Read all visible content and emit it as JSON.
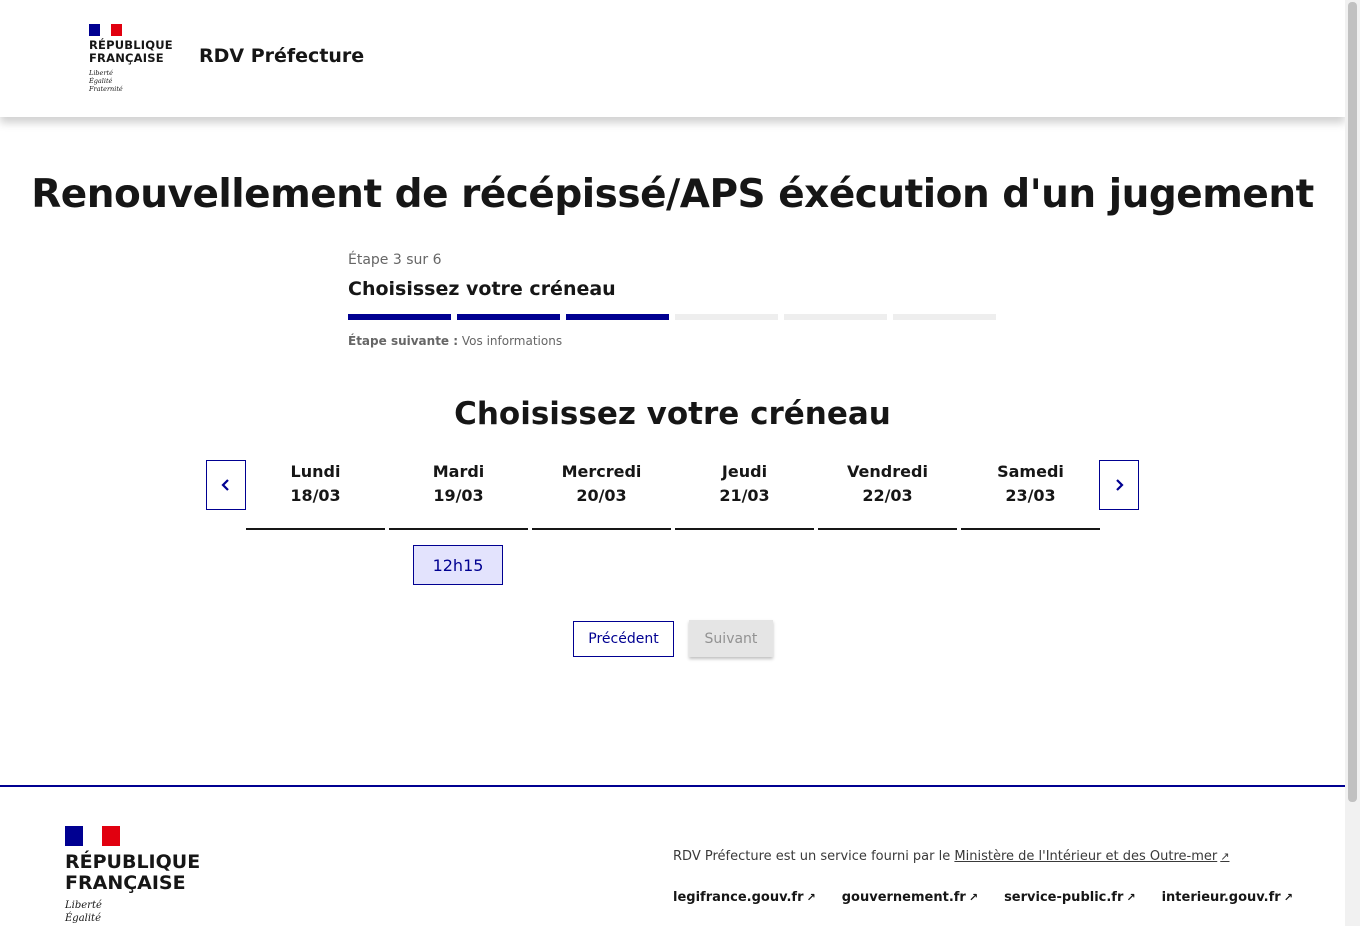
{
  "header": {
    "republic_lines": [
      "RÉPUBLIQUE",
      "FRANÇAISE"
    ],
    "motto_lines": [
      "Liberté",
      "Égalité",
      "Fraternité"
    ],
    "service_title": "RDV Préfecture"
  },
  "page_title": "Renouvellement de récépissé/APS éxécution d'un jugement",
  "stepper": {
    "state": "Étape 3 sur 6",
    "title": "Choisissez votre créneau",
    "total_steps": 6,
    "current_step": 3,
    "next_label": "Étape suivante :",
    "next_value": "Vos informations"
  },
  "slots": {
    "title": "Choisissez votre créneau",
    "days": [
      {
        "name": "Lundi",
        "date": "18/03"
      },
      {
        "name": "Mardi",
        "date": "19/03"
      },
      {
        "name": "Mercredi",
        "date": "20/03"
      },
      {
        "name": "Jeudi",
        "date": "21/03"
      },
      {
        "name": "Vendredi",
        "date": "22/03"
      },
      {
        "name": "Samedi",
        "date": "23/03"
      }
    ],
    "available_slot": "12h15"
  },
  "buttons": {
    "previous": "Précédent",
    "next": "Suivant"
  },
  "footer": {
    "republic_lines": [
      "RÉPUBLIQUE",
      "FRANÇAISE"
    ],
    "motto_lines": [
      "Liberté",
      "Égalité"
    ],
    "description_prefix": "RDV Préfecture est un service fourni par le",
    "description_link": "Ministère de l'Intérieur et des Outre-mer",
    "links": [
      "legifrance.gouv.fr",
      "gouvernement.fr",
      "service-public.fr",
      "interieur.gouv.fr"
    ]
  },
  "colors": {
    "primary": "#000091",
    "flag_red": "#e1000f",
    "slot_bg": "#e3e3fd",
    "disabled_bg": "#e5e5e5"
  },
  "icons": {
    "prev": "chevron-left-icon",
    "next": "chevron-right-icon",
    "external": "external-link-icon"
  }
}
